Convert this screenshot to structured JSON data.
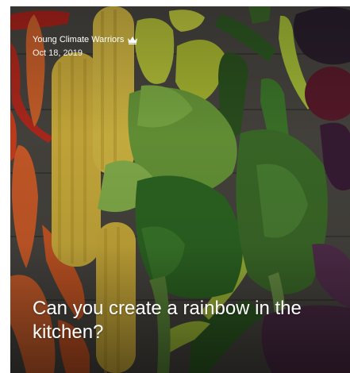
{
  "post": {
    "author": "Young Climate Warriors",
    "author_badge_icon": "crown-icon",
    "date": "Oct 18, 2019",
    "title": "Can you create a rainbow in the kitchen?"
  },
  "image": {
    "subject": "vegetables-rainbow-photo"
  },
  "colors": {
    "text": "#ffffff"
  }
}
